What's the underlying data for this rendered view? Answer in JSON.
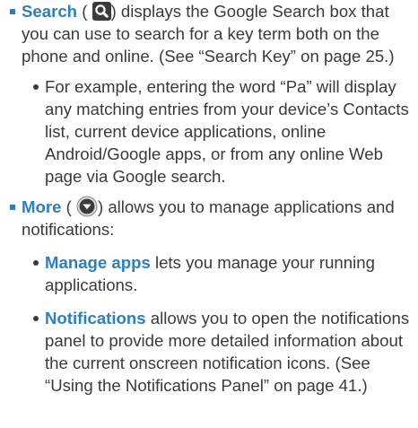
{
  "items": {
    "search": {
      "term": "Search",
      "paren_open": " (",
      "icon": "search-icon",
      "text": ") displays the Google Search box that you can use to search for a key term both on the phone and online. (See “Search Key” on page 25.)",
      "sub": [
        {
          "text": "For example, entering the word “Pa” will display any matching entries from your device’s Contacts list, current device applications, online Android/Google apps, or from any online Web page via Google search."
        }
      ]
    },
    "more": {
      "term": "More",
      "paren_open": " (",
      "icon": "more-icon",
      "text": ") allows you to manage applications and notifications:",
      "sub": [
        {
          "term": "Manage apps",
          "text": " lets you manage your running applications."
        },
        {
          "term": "Notifications",
          "text": " allows you to open the notifications panel to provide more detailed information about the current onscreen notification icons. (See “Using the Notifications Panel” on page 41.)"
        }
      ]
    }
  },
  "colors": {
    "accent": "#2d7fbf",
    "text": "#3a3a3a",
    "icon_dark": "#3b3b3b"
  }
}
